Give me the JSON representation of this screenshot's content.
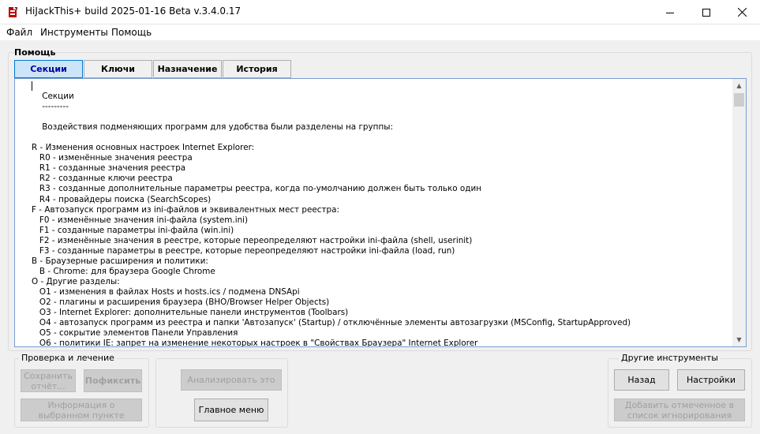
{
  "window": {
    "title": "HiJackThis+ build 2025-01-16 Beta v.3.4.0.17",
    "minimize_glyph": "—",
    "maximize_glyph": "☐",
    "close_glyph": "✕"
  },
  "menu": [
    "Файл",
    "Инструменты",
    "Помощь"
  ],
  "help_group": {
    "title": "Помощь",
    "tabs": [
      "Секции",
      "Ключи",
      "Назначение",
      "История"
    ],
    "active_tab": "Секции"
  },
  "help_text": [
    "",
    "    Секции",
    "    ---------",
    "",
    "    Воздействия подменяющих программ для удобства были разделены на группы:",
    "",
    "R - Изменения основных настроек Internet Explorer:",
    "   R0 - изменённые значения реестра",
    "   R1 - созданные значения реестра",
    "   R2 - созданные ключи реестра",
    "   R3 - созданные дополнительные параметры реестра, когда по-умолчанию должен быть только один",
    "   R4 - провайдеры поиска (SearchScopes)",
    "F - Автозапуск программ из ini-файлов и эквивалентных мест реестра:",
    "   F0 - изменённые значения ini-файла (system.ini)",
    "   F1 - созданные параметры ini-файла (win.ini)",
    "   F2 - изменённые значения в реестре, которые переопределяют настройки ini-файла (shell, userinit)",
    "   F3 - созданные параметры в реестре, которые переопределяют настройки ini-файла (load, run)",
    "B - Браузерные расширения и политики:",
    "   B - Chrome: для браузера Google Chrome",
    "O - Другие разделы:",
    "   O1 - изменения в файлах Hosts и hosts.ics / подмена DNSApi",
    "   O2 - плагины и расширения браузера (BHO/Browser Helper Objects)",
    "   O3 - Internet Explorer: дополнительные панели инструментов (Toolbars)",
    "   O4 - автозапуск программ из реестра и папки 'Автозапуск' (Startup) / отключённые элементы автозагрузки (MSConfig, StartupApproved)",
    "   O5 - сокрытие элементов Панели Управления",
    "   O6 - политики IE: запрет на изменение некоторых настроек в \"Свойствах Браузера\" Internet Explorer"
  ],
  "scan_fix": {
    "legend": "Проверка и лечение",
    "save_report": "Сохранить отчёт...",
    "fix": "Пофиксить",
    "info_selected": "Информация о выбранном пункте"
  },
  "middle": {
    "analyze": "Анализировать это",
    "main_menu": "Главное меню"
  },
  "other_tools": {
    "legend": "Другие инструменты",
    "back": "Назад",
    "settings": "Настройки",
    "add_ignore": "Добавить отмеченное в список игнорирования"
  },
  "colors": {
    "accent": "#0078d7",
    "active_tab_bg": "#cce4f7",
    "disabled_text": "#a0a0a0"
  }
}
